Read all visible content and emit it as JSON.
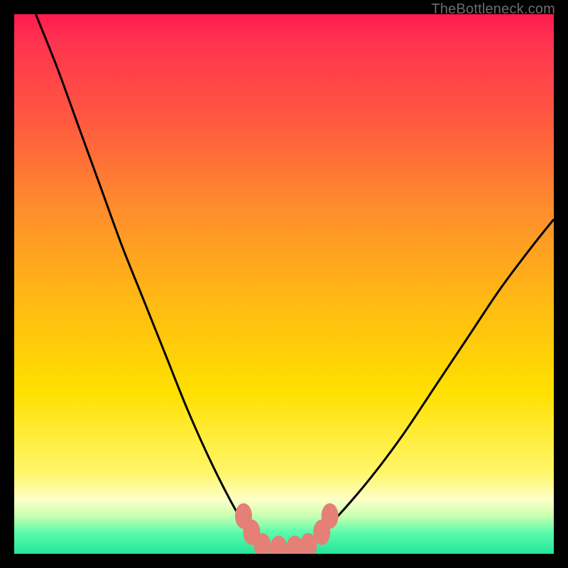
{
  "watermark": {
    "text": "TheBottleneck.com"
  },
  "chart_data": {
    "type": "line",
    "title": "",
    "xlabel": "",
    "ylabel": "",
    "xlim": [
      0,
      100
    ],
    "ylim": [
      0,
      100
    ],
    "grid": false,
    "legend": false,
    "notes": "Asymmetric V-shaped bottleneck curve on a red→green vertical gradient. y=100 corresponds to the top (red / worst), y=0 to the bottom (green / best). Minimum flattens to ~1 around x≈45–55. The coral markers are a cluster sitting on that flat minimum.",
    "series": [
      {
        "name": "left-branch",
        "stroke": "#000000",
        "x": [
          4,
          8,
          12,
          16,
          20,
          24,
          28,
          32,
          36,
          40,
          44
        ],
        "y": [
          100,
          90,
          79,
          68,
          57,
          47,
          37,
          27,
          18,
          10,
          3
        ]
      },
      {
        "name": "flat-minimum",
        "stroke": "#000000",
        "x": [
          44,
          48,
          52,
          56
        ],
        "y": [
          3,
          1,
          1,
          3
        ]
      },
      {
        "name": "right-branch",
        "stroke": "#000000",
        "x": [
          56,
          60,
          66,
          72,
          78,
          84,
          90,
          96,
          100
        ],
        "y": [
          3,
          7,
          14,
          22,
          31,
          40,
          49,
          57,
          62
        ]
      }
    ],
    "markers": {
      "name": "highlighted-points",
      "color": "#e58077",
      "note": "Coral lozenge shapes clustered along the flat bottom of the V, with a couple slightly up the walls.",
      "points": [
        {
          "x": 42.5,
          "y": 7
        },
        {
          "x": 44.0,
          "y": 4
        },
        {
          "x": 46.0,
          "y": 1.5
        },
        {
          "x": 49.0,
          "y": 1.0
        },
        {
          "x": 52.0,
          "y": 1.0
        },
        {
          "x": 54.5,
          "y": 1.5
        },
        {
          "x": 57.0,
          "y": 4
        },
        {
          "x": 58.5,
          "y": 7
        }
      ]
    },
    "background_gradient_stops": [
      {
        "pos": 0,
        "color": "#ff1a4d"
      },
      {
        "pos": 20,
        "color": "#ff5a3f"
      },
      {
        "pos": 50,
        "color": "#ffb217"
      },
      {
        "pos": 70,
        "color": "#ffe000"
      },
      {
        "pos": 90,
        "color": "#fdffc8"
      },
      {
        "pos": 96,
        "color": "#5cfcac"
      },
      {
        "pos": 100,
        "color": "#26e59a"
      }
    ]
  }
}
